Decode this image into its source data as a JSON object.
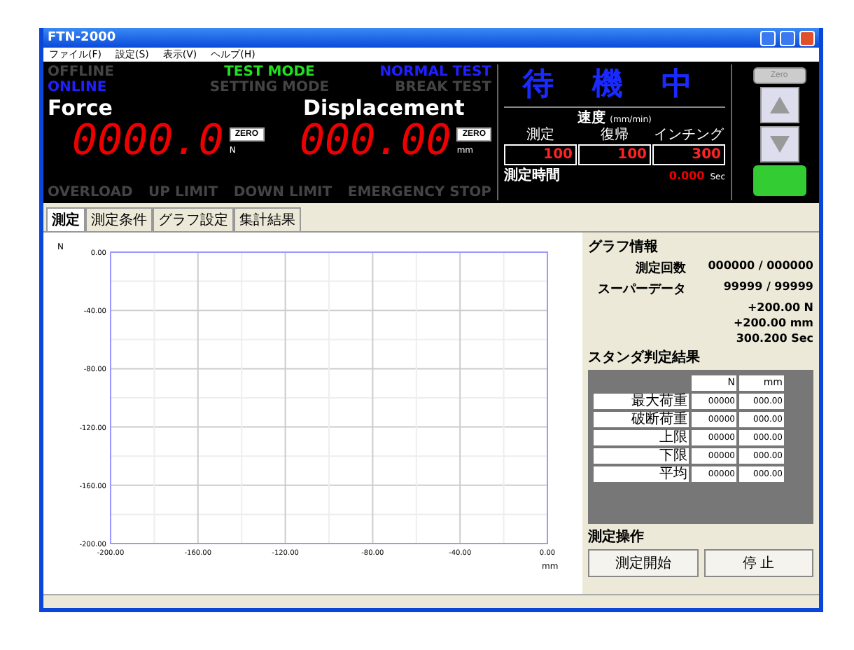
{
  "window": {
    "title": "FTN-2000"
  },
  "menu": [
    "ファイル(F)",
    "設定(S)",
    "表示(V)",
    "ヘルプ(H)"
  ],
  "indicators": [
    {
      "label": "OFFLINE",
      "lit": false
    },
    {
      "label": "TEST MODE",
      "lit": true,
      "color": "#20e020"
    },
    {
      "label": "NORMAL TEST",
      "lit": true,
      "color": "#2020ff"
    },
    {
      "label": "ONLINE",
      "lit": true,
      "color": "#2020ff"
    },
    {
      "label": "SETTING MODE",
      "lit": false
    },
    {
      "label": "BREAK TEST",
      "lit": false
    }
  ],
  "meters": [
    {
      "label": "Force",
      "value": "0000.0",
      "zero": "ZERO",
      "unit": "N"
    },
    {
      "label": "Displacement",
      "value": "000.00",
      "zero": "ZERO",
      "unit": "mm"
    }
  ],
  "alarms": [
    {
      "label": "OVERLOAD",
      "lit": false
    },
    {
      "label": "UP LIMIT",
      "lit": false
    },
    {
      "label": "DOWN LIMIT",
      "lit": false
    },
    {
      "label": "EMERGENCY STOP",
      "lit": false
    }
  ],
  "status": "待 機 中",
  "speed": {
    "title": "速度",
    "unit": "(mm/min)",
    "fields": [
      {
        "label": "測定",
        "value": "100"
      },
      {
        "label": "復帰",
        "value": "100"
      },
      {
        "label": "インチング",
        "value": "300"
      }
    ]
  },
  "time": {
    "label": "測定時間",
    "value": "0.000",
    "unit": "Sec"
  },
  "jog": {
    "top": "Zero",
    "up_enabled": true,
    "down_enabled": true,
    "ready": true
  },
  "tabs": [
    {
      "label": "測定",
      "selected": true
    },
    {
      "label": "測定条件",
      "selected": false
    },
    {
      "label": "グラフ設定",
      "selected": false
    },
    {
      "label": "集計結果",
      "selected": false
    }
  ],
  "graph": {
    "y_unit": "N",
    "x_unit": "mm",
    "yticks": [
      "0.00",
      "-40.00",
      "-80.00",
      "-120.00",
      "-160.00",
      "-200.00"
    ],
    "xticks": [
      "-200.00",
      "-160.00",
      "-120.00",
      "-80.00",
      "-40.00",
      "0.00"
    ]
  },
  "graph_info": {
    "title": "グラフ情報",
    "rows": [
      {
        "label": "測定回数",
        "value": "000000 / 000000"
      },
      {
        "label": "スーパーデータ",
        "value": "99999 / 99999"
      },
      {
        "value": "+200.00 N"
      },
      {
        "value": "+200.00 mm"
      },
      {
        "value": "300.200 Sec"
      }
    ]
  },
  "results": {
    "title": "スタンダ判定結果",
    "columns": [
      "N",
      "mm"
    ],
    "rows": [
      {
        "label": "最大荷重",
        "values": [
          "00000",
          "000.00"
        ]
      },
      {
        "label": "破断荷重",
        "values": [
          "00000",
          "000.00"
        ]
      },
      {
        "label": "上限",
        "values": [
          "00000",
          "000.00"
        ]
      },
      {
        "label": "下限",
        "values": [
          "00000",
          "000.00"
        ]
      },
      {
        "label": "平均",
        "values": [
          "00000",
          "000.00"
        ]
      }
    ]
  },
  "operation": {
    "title": "測定操作",
    "buttons": [
      "測定開始",
      "停 止"
    ]
  }
}
